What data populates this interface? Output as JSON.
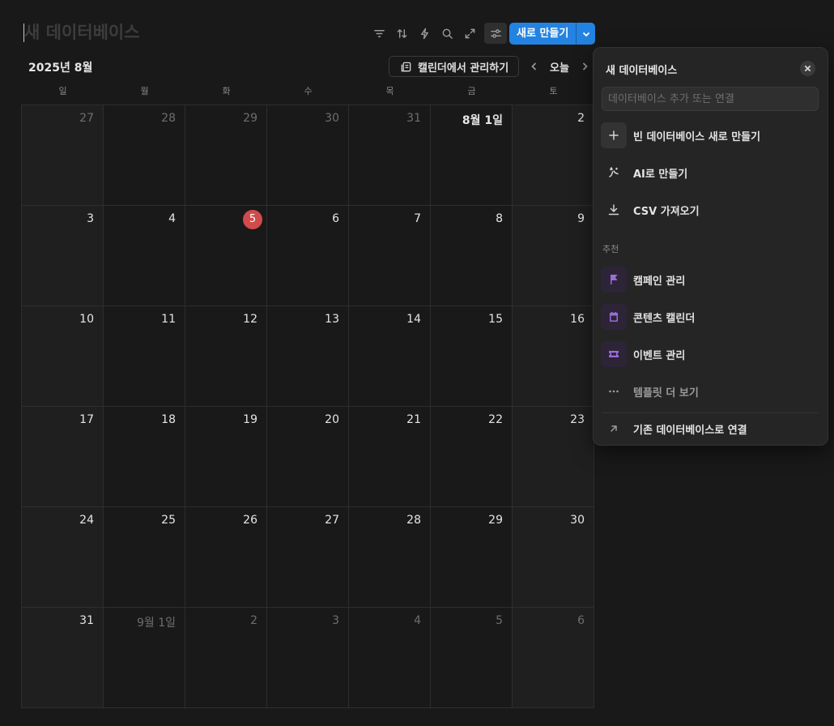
{
  "header": {
    "db_title": "새 데이터베이스",
    "new_button": "새로 만들기"
  },
  "toolbar": {
    "icons": [
      "filter-icon",
      "sort-icon",
      "automation-icon",
      "search-icon",
      "expand-icon",
      "settings-icon"
    ]
  },
  "calendar": {
    "month_label": "2025년 8월",
    "manage_button": "캘린더에서 관리하기",
    "today_button": "오늘",
    "weekdays": [
      "일",
      "월",
      "화",
      "수",
      "목",
      "금",
      "토"
    ],
    "weeks": [
      [
        "27",
        "28",
        "29",
        "30",
        "31",
        "8월 1일",
        "2"
      ],
      [
        "3",
        "4",
        "5",
        "6",
        "7",
        "8",
        "9"
      ],
      [
        "10",
        "11",
        "12",
        "13",
        "14",
        "15",
        "16"
      ],
      [
        "17",
        "18",
        "19",
        "20",
        "21",
        "22",
        "23"
      ],
      [
        "24",
        "25",
        "26",
        "27",
        "28",
        "29",
        "30"
      ],
      [
        "31",
        "9월 1일",
        "2",
        "3",
        "4",
        "5",
        "6"
      ]
    ],
    "today": "5"
  },
  "panel": {
    "title": "새 데이터베이스",
    "search_placeholder": "데이터베이스 추가 또는 연결",
    "items": {
      "new_empty": "빈 데이터베이스 새로 만들기",
      "ai_create": "AI로 만들기",
      "csv_import": "CSV 가져오기"
    },
    "section_label": "추천",
    "templates": {
      "campaign": "캠페인 관리",
      "content_calendar": "콘텐츠 캘린더",
      "event": "이벤트 관리",
      "more": "템플릿 더 보기"
    },
    "link_existing": "기존 데이터베이스로 연결"
  },
  "colors": {
    "accent": "#2383e2",
    "today": "#d04b4b",
    "template_icon": "#9a6dd7"
  }
}
